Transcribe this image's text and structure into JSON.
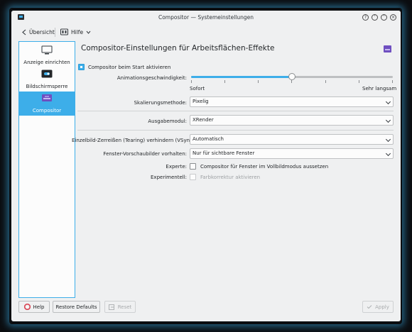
{
  "window": {
    "title": "Compositor — Systemeinstellungen"
  },
  "toolbar": {
    "back_label": "Übersicht",
    "help_label": "Hilfe"
  },
  "sidebar": {
    "items": [
      {
        "label": "Anzeige einrichten",
        "icon": "monitor-icon",
        "active": false
      },
      {
        "label": "Bildschirmsperre",
        "icon": "screen-lock-icon",
        "active": false
      },
      {
        "label": "Compositor",
        "icon": "compositor-icon",
        "active": true
      }
    ]
  },
  "main": {
    "heading": "Compositor-Einstellungen für Arbeitsflächen-Effekte",
    "enable_on_start": {
      "label": "Compositor beim Start aktivieren",
      "checked": true
    },
    "animation_speed": {
      "label": "Animationsgeschwindigkeit:",
      "min_label": "Sofort",
      "max_label": "Sehr langsam",
      "value_fraction": 0.5
    },
    "scaling": {
      "label": "Skalierungsmethode:",
      "value": "Pixelig"
    },
    "backend": {
      "label": "Ausgabemodul:",
      "value": "XRender"
    },
    "vsync": {
      "label": "Einzelbild-Zerreißen (Tearing) verhindern (VSync):",
      "value": "Automatisch"
    },
    "thumbnails": {
      "label": "Fenster-Vorschaubilder vorhalten:",
      "value": "Nur für sichtbare Fenster"
    },
    "expert": {
      "label": "Experte:",
      "option": "Compositor für Fenster im Vollbildmodus aussetzen",
      "checked": false
    },
    "experimental": {
      "label": "Experimentell:",
      "option": "Farbkorrektur aktivieren",
      "checked": false,
      "enabled": false
    }
  },
  "footer": {
    "help": "Help",
    "restore_defaults": "Restore Defaults",
    "reset": "Reset",
    "apply": "Apply"
  },
  "colors": {
    "accent": "#3daee9",
    "window_bg": "#eff0f1",
    "text": "#232629"
  }
}
